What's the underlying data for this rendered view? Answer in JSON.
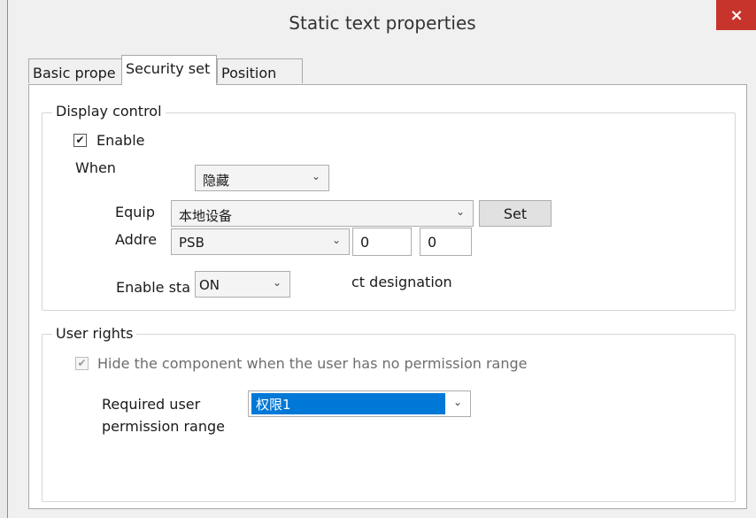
{
  "window": {
    "title": "Static text properties",
    "close_glyph": "×"
  },
  "tabs": [
    {
      "label": "Basic prope",
      "active": false
    },
    {
      "label": "Security set",
      "active": true
    },
    {
      "label": "Position",
      "active": false
    }
  ],
  "display_control": {
    "legend": "Display control",
    "enable": {
      "label": "Enable",
      "checked": true,
      "check_glyph": "✔"
    },
    "when": {
      "label": "When",
      "value": "隐藏"
    },
    "equip": {
      "label": "Equip",
      "value": "本地设备",
      "set_label": "Set"
    },
    "address": {
      "label": "Addre",
      "value": "PSB",
      "field1": "0",
      "field2": "0"
    },
    "enable_state": {
      "label": "Enable sta",
      "value": "ON",
      "trailing_text": "ct designation"
    },
    "chevron_glyph": "⌄"
  },
  "user_rights": {
    "legend": "User rights",
    "hide_checkbox": {
      "label": "Hide the component when the user has no permission range",
      "checked": true,
      "disabled": true,
      "check_glyph": "✔"
    },
    "required_label_line1": "Required user",
    "required_label_line2": "permission range",
    "permission": {
      "value": "权限1",
      "selected_color": "#0078d7"
    }
  }
}
